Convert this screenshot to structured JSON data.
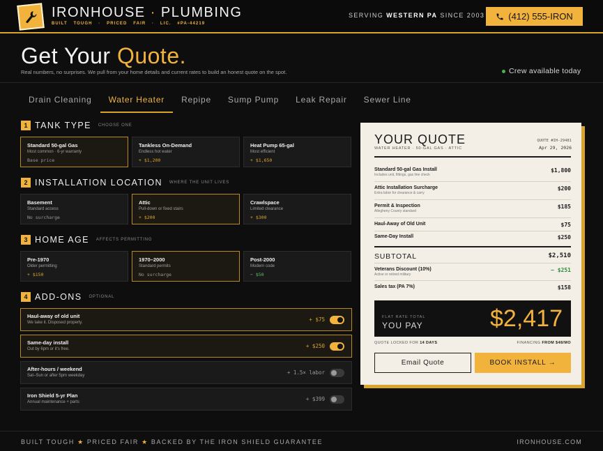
{
  "header": {
    "brand_name": "IRONHOUSE",
    "brand_sep": "·",
    "brand_trade": "PLUMBING",
    "tagline": "BUILT TOUGH · PRICED FAIR · LIC. #PA-44219",
    "serving_prefix": "SERVING",
    "serving_region": "WESTERN PA",
    "serving_suffix": "SINCE 2003",
    "phone_label": "(412) 555-IRON",
    "logo_icon": "wrench-icon",
    "phone_icon": "phone-icon"
  },
  "hero": {
    "title_main": "Get Your",
    "title_accent": "Quote.",
    "subtitle": "Real numbers, no surprises. We pull from your home details and current rates to build an honest quote on the spot.",
    "crew_status": "Crew available today"
  },
  "tabs": [
    {
      "label": "Drain Cleaning",
      "active": false
    },
    {
      "label": "Water Heater",
      "active": true
    },
    {
      "label": "Repipe",
      "active": false
    },
    {
      "label": "Sump Pump",
      "active": false
    },
    {
      "label": "Leak Repair",
      "active": false
    },
    {
      "label": "Sewer Line",
      "active": false
    }
  ],
  "sections": {
    "tank": {
      "num": "1",
      "title": "TANK TYPE",
      "sub": "CHOOSE ONE",
      "options": [
        {
          "title": "Standard 50-gal Gas",
          "desc": "Most common · 6-yr warranty",
          "price": "Base price",
          "selected": true
        },
        {
          "title": "Tankless On-Demand",
          "desc": "Endless hot water",
          "price": "+ $1,200",
          "selected": false
        },
        {
          "title": "Heat Pump 65-gal",
          "desc": "Most efficient",
          "price": "+ $1,650",
          "selected": false
        }
      ]
    },
    "location": {
      "num": "2",
      "title": "INSTALLATION LOCATION",
      "sub": "WHERE THE UNIT LIVES",
      "options": [
        {
          "title": "Basement",
          "desc": "Standard access",
          "price": "No surcharge",
          "selected": false
        },
        {
          "title": "Attic",
          "desc": "Pull-down or fixed stairs",
          "price": "+ $200",
          "selected": true
        },
        {
          "title": "Crawlspace",
          "desc": "Limited clearance",
          "price": "+ $300",
          "selected": false
        }
      ]
    },
    "age": {
      "num": "3",
      "title": "HOME AGE",
      "sub": "AFFECTS PERMITTING",
      "options": [
        {
          "title": "Pre-1970",
          "desc": "Older permitting",
          "price": "+ $150",
          "selected": false
        },
        {
          "title": "1970–2000",
          "desc": "Standard permits",
          "price": "No surcharge",
          "selected": true
        },
        {
          "title": "Post-2000",
          "desc": "Modern code",
          "price": "− $50",
          "selected": false
        }
      ]
    },
    "addons": {
      "num": "4",
      "title": "ADD-ONS",
      "sub": "OPTIONAL",
      "items": [
        {
          "title": "Haul-away of old unit",
          "desc": "We take it. Disposed properly.",
          "price": "+ $75",
          "on": true
        },
        {
          "title": "Same-day install",
          "desc": "Out by 6pm or it's free.",
          "price": "+ $250",
          "on": true
        },
        {
          "title": "After-hours / weekend",
          "desc": "Sat–Sun or after 5pm weekday",
          "price": "+ 1.5× labor",
          "on": false
        },
        {
          "title": "Iron Shield 5-yr Plan",
          "desc": "Annual maintenance + parts",
          "price": "+ $399",
          "on": false
        }
      ]
    }
  },
  "quote": {
    "title": "YOUR QUOTE",
    "subtitle": "WATER HEATER · 50-GAL GAS · ATTIC",
    "quote_id": "QUOTE #IH-29481",
    "date": "Apr 29, 2026",
    "lines": [
      {
        "name": "Standard 50-gal Gas Install",
        "sub": "Includes unit, fittings, gas line check",
        "amount": "$1,800"
      },
      {
        "name": "Attic Installation Surcharge",
        "sub": "Extra labor for clearance & carry",
        "amount": "$200"
      },
      {
        "name": "Permit & Inspection",
        "sub": "Allegheny County standard",
        "amount": "$185"
      },
      {
        "name": "Haul-Away of Old Unit",
        "sub": "",
        "amount": "$75"
      },
      {
        "name": "Same-Day Install",
        "sub": "",
        "amount": "$250"
      }
    ],
    "subtotal_label": "SUBTOTAL",
    "subtotal": "$2,510",
    "discount": {
      "name": "Veterans Discount (10%)",
      "sub": "Active or retired military",
      "amount": "− $251"
    },
    "tax": {
      "name": "Sales tax (PA 7%)",
      "amount": "$158"
    },
    "flat_label": "FLAT RATE TOTAL",
    "you_pay": "YOU PAY",
    "total": "$2,417",
    "lock_prefix": "QUOTE LOCKED FOR",
    "lock_days": "14 DAYS",
    "fin_prefix": "FINANCING",
    "fin_value": "FROM $48/MO",
    "email_button": "Email Quote",
    "book_button": "BOOK INSTALL →"
  },
  "footer": {
    "parts": [
      "BUILT TOUGH",
      "PRICED FAIR",
      "BACKED BY THE IRON SHIELD GUARANTEE"
    ],
    "star": "★",
    "site": "IRONHOUSE.COM"
  },
  "colors": {
    "accent": "#f2b33d",
    "background": "#0e0e0e",
    "paper": "#f3efe6",
    "success": "#4caf50"
  }
}
